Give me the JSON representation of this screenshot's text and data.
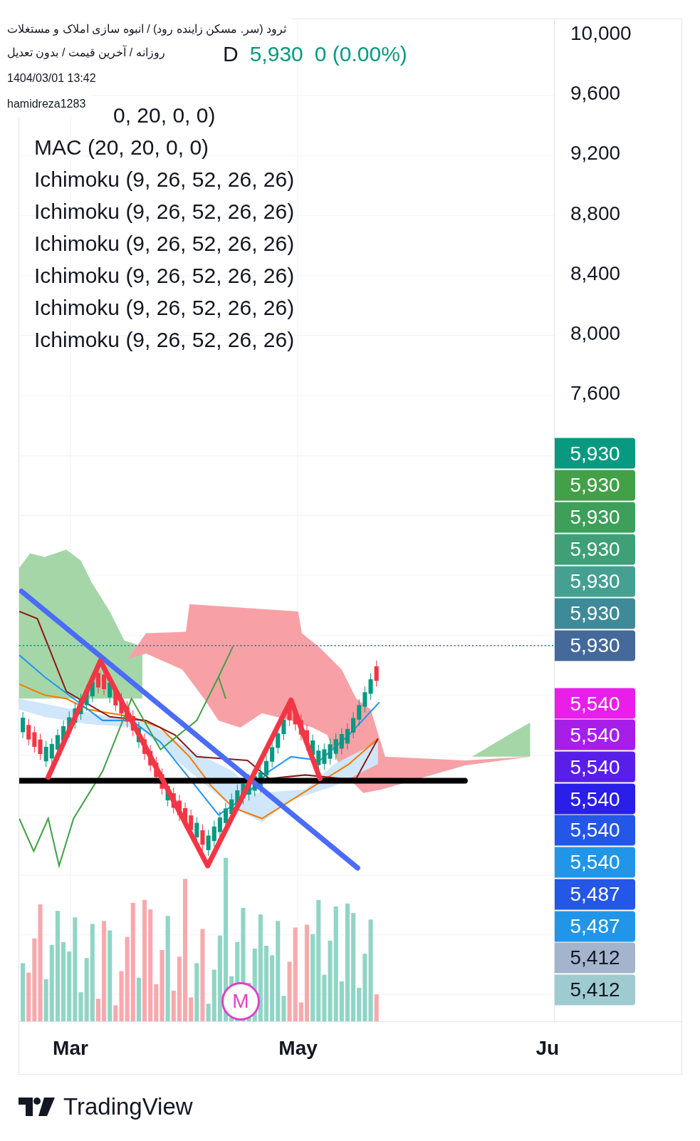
{
  "header": {
    "lines": [
      "ثرود (سر. مسکن زاینده رود) / انبوه سازی املاک و مستغلات",
      "روزانه / آخرین قیمت / بدون تعدیل",
      "1404/03/01 13:42",
      "hamidreza1283"
    ]
  },
  "legend": {
    "interval": "D",
    "price": "5,930",
    "change": "0 (0.00%)",
    "rows": [
      {
        "kind": "cut",
        "text": "0, 20, 0, 0)"
      },
      {
        "kind": "full",
        "text": "MAC (20, 20, 0, 0)"
      },
      {
        "kind": "full",
        "text": "Ichimoku (9, 26, 52, 26, 26)"
      },
      {
        "kind": "full",
        "text": "Ichimoku (9, 26, 52, 26, 26)"
      },
      {
        "kind": "full",
        "text": "Ichimoku (9, 26, 52, 26, 26)"
      },
      {
        "kind": "full",
        "text": "Ichimoku (9, 26, 52, 26, 26)"
      },
      {
        "kind": "full",
        "text": "Ichimoku (9, 26, 52, 26, 26)"
      },
      {
        "kind": "full",
        "text": "Ichimoku (9, 26, 52, 26, 26)"
      }
    ]
  },
  "price_axis": {
    "ticks": [
      "10,000",
      "9,600",
      "9,200",
      "8,800",
      "8,400",
      "8,000",
      "7,600"
    ],
    "badges": [
      {
        "text": "5,930",
        "color": "#089981"
      },
      {
        "text": "5,930",
        "color": "#43a047"
      },
      {
        "text": "5,930",
        "color": "#3d9f5a"
      },
      {
        "text": "5,930",
        "color": "#3f9f77"
      },
      {
        "text": "5,930",
        "color": "#45a092"
      },
      {
        "text": "5,930",
        "color": "#3f8a98"
      },
      {
        "text": "5,930",
        "color": "#44699b"
      },
      {
        "text": "5,540",
        "color": "#e91ee9"
      },
      {
        "text": "5,540",
        "color": "#a81ee9"
      },
      {
        "text": "5,540",
        "color": "#5a1ee9"
      },
      {
        "text": "5,540",
        "color": "#2a1ee9"
      },
      {
        "text": "5,540",
        "color": "#2456e8"
      },
      {
        "text": "5,540",
        "color": "#2196e9"
      },
      {
        "text": "5,487",
        "color": "#2456e8"
      },
      {
        "text": "5,487",
        "color": "#2196e9"
      },
      {
        "text": "5,412",
        "color": "#a3b4cc"
      },
      {
        "text": "5,412",
        "color": "#9ecbd0"
      }
    ]
  },
  "time_axis": {
    "labels": [
      "Mar",
      "May",
      "Ju"
    ]
  },
  "marker": {
    "text": "M"
  },
  "footer": {
    "brand": "TradingView"
  }
}
